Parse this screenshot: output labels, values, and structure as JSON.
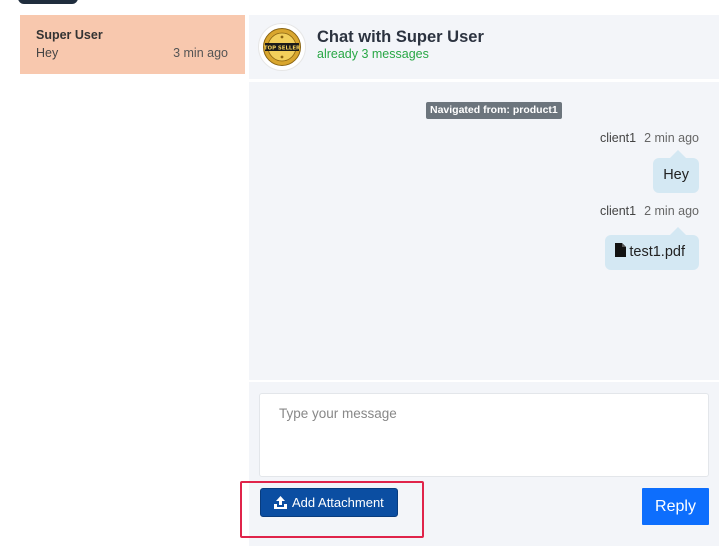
{
  "conversations": [
    {
      "name": "Super User",
      "preview": "Hey",
      "time": "3 min ago"
    }
  ],
  "chat": {
    "title": "Chat with Super User",
    "subtitle": "already 3 messages",
    "avatar_icon": "top-seller-badge-icon",
    "avatar_text": "TOP SELLER"
  },
  "messages": {
    "nav_badge": "Navigated from: product1",
    "items": [
      {
        "author": "client1",
        "time": "2 min ago",
        "text": "Hey",
        "kind": "text"
      },
      {
        "author": "client1",
        "time": "2 min ago",
        "text": "test1.pdf",
        "kind": "file",
        "icon": "file-icon"
      }
    ]
  },
  "composer": {
    "placeholder": "Type your message",
    "value": "",
    "attach_label": "Add Attachment",
    "attach_icon": "upload-icon",
    "reply_label": "Reply"
  },
  "colors": {
    "active_conversation": "#f8c8ae",
    "panel_bg": "#f3f5f9",
    "bubble": "#d4e8f3",
    "subtitle_green": "#28a745",
    "attach_button": "#0b4ea2",
    "reply_button": "#0d6efd",
    "highlight": "#e0244a"
  }
}
